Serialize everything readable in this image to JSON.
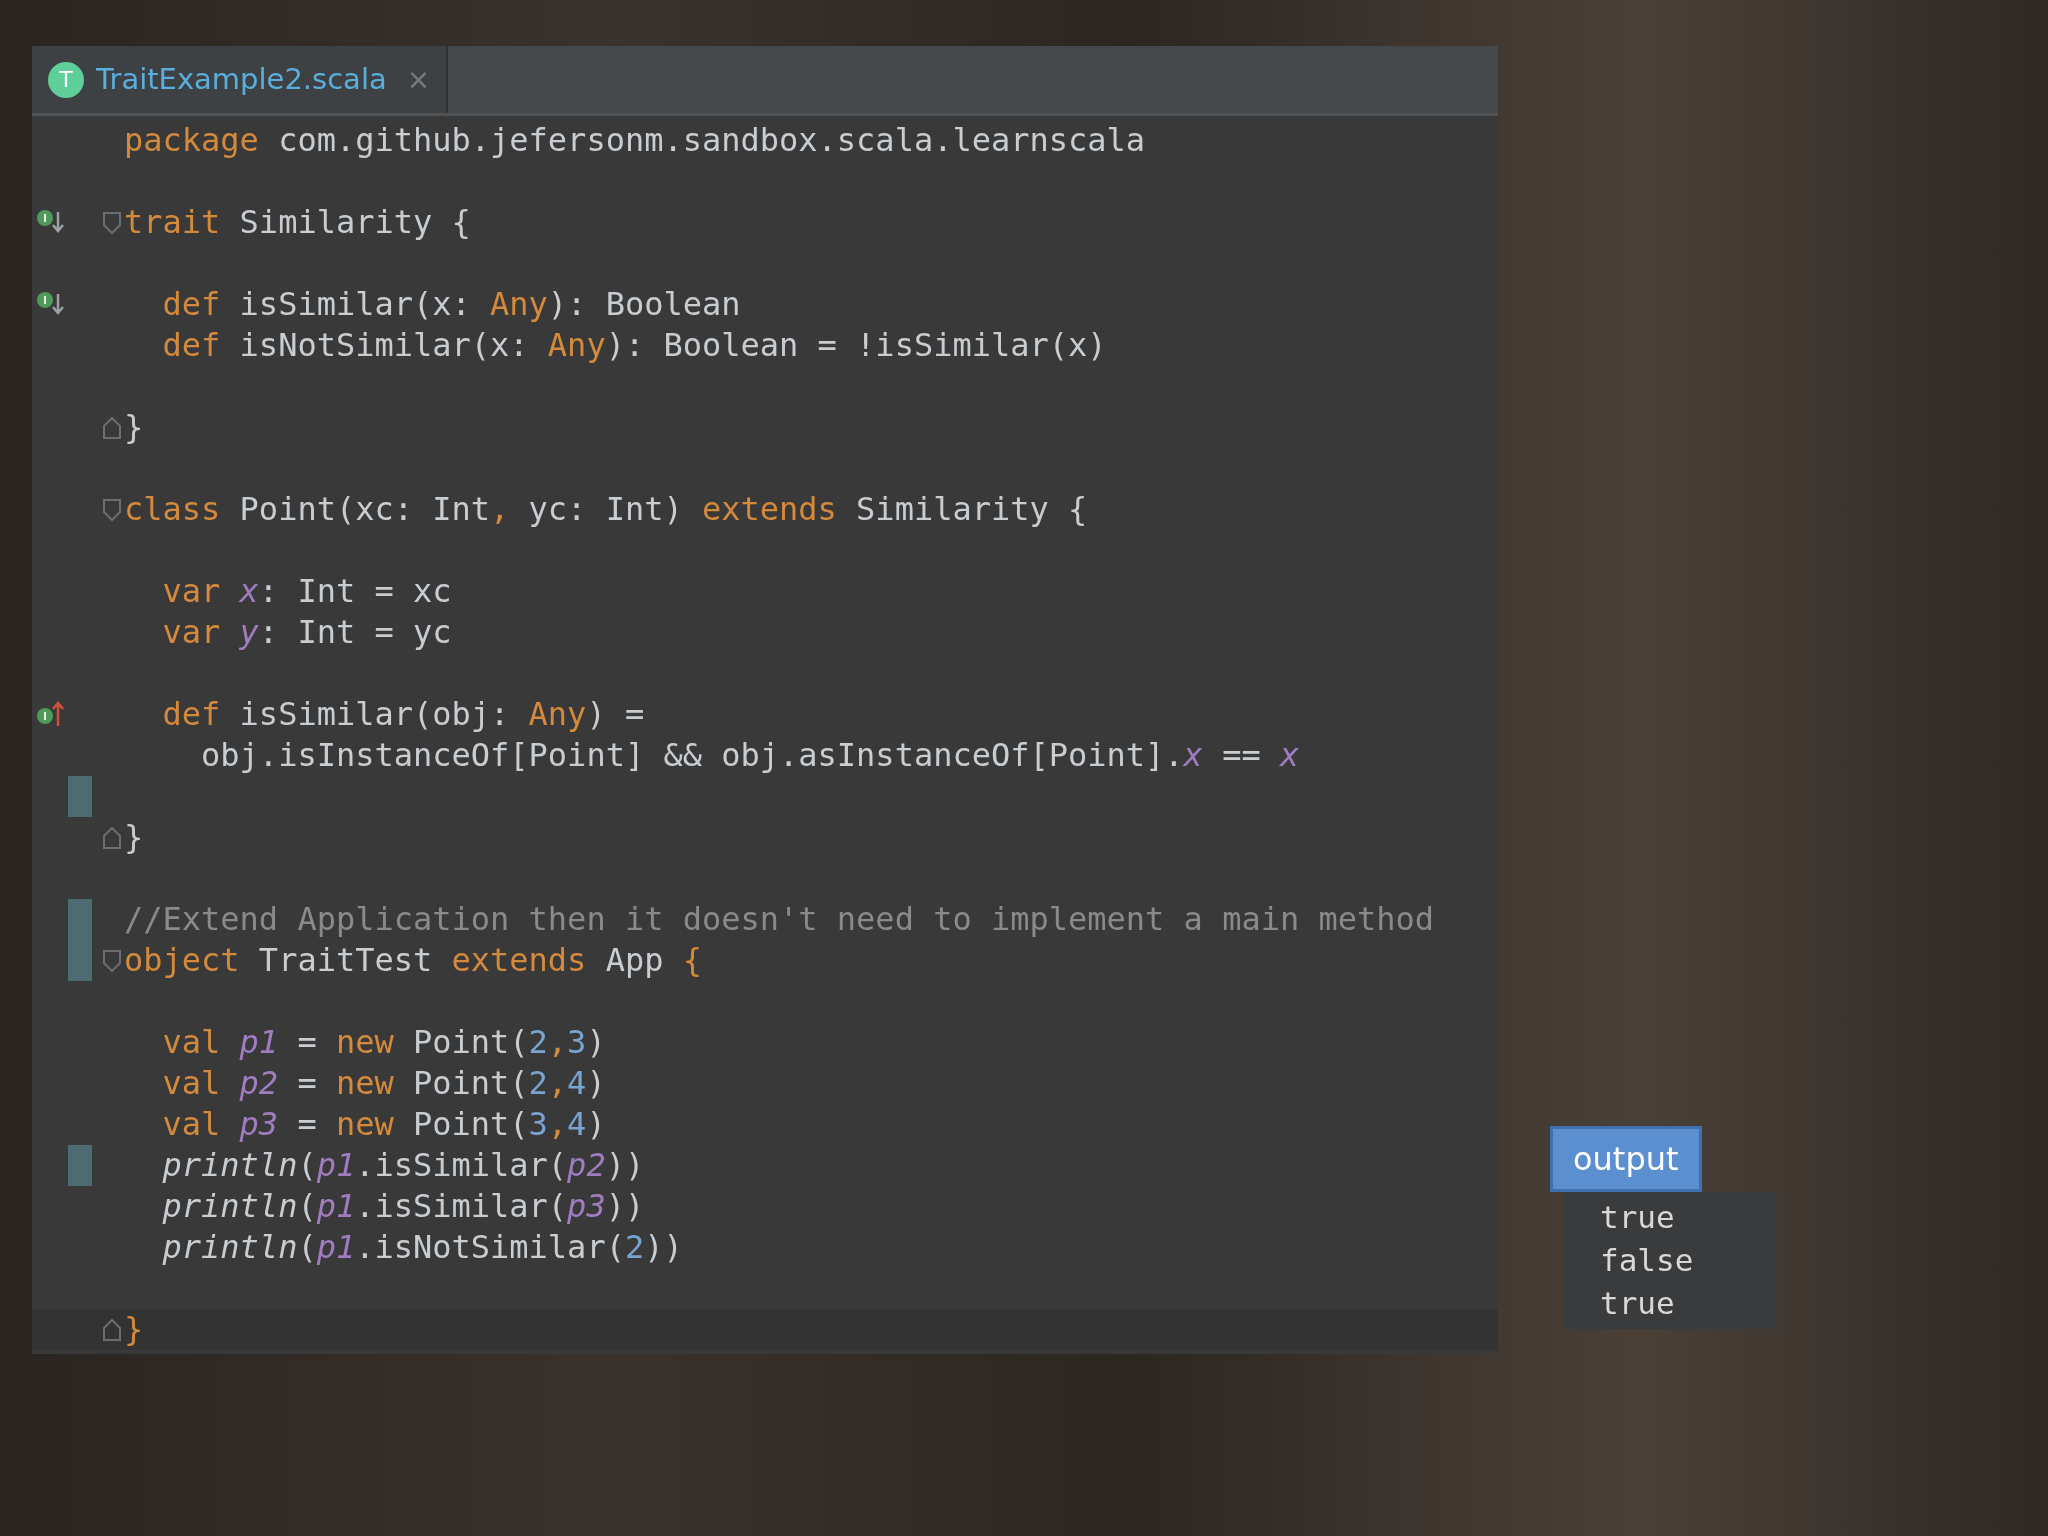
{
  "tab": {
    "icon_letter": "T",
    "label": "TraitExample2.scala",
    "close": "×",
    "selected": true
  },
  "lines": [
    {
      "kind": "code",
      "tokens": [
        {
          "kind": "kw",
          "t": "package"
        },
        {
          "kind": "plain",
          "t": " com.github.jefersonm.sandbox.scala.learnscala"
        }
      ]
    },
    {
      "kind": "blank"
    },
    {
      "kind": "code",
      "gutter": {
        "kind": "implemented"
      },
      "fold": {
        "kind": "start"
      },
      "tokens": [
        {
          "kind": "kw",
          "t": "trait"
        },
        {
          "kind": "plain",
          "t": " Similarity {"
        }
      ]
    },
    {
      "kind": "blank"
    },
    {
      "kind": "code",
      "gutter": {
        "kind": "implemented"
      },
      "tokens": [
        {
          "kind": "kw",
          "t": "  def"
        },
        {
          "kind": "plain",
          "t": " isSimilar(x: "
        },
        {
          "kind": "kw",
          "t": "Any"
        },
        {
          "kind": "plain",
          "t": "): Boolean"
        }
      ]
    },
    {
      "kind": "code",
      "tokens": [
        {
          "kind": "kw",
          "t": "  def"
        },
        {
          "kind": "plain",
          "t": " isNotSimilar(x: "
        },
        {
          "kind": "kw",
          "t": "Any"
        },
        {
          "kind": "plain",
          "t": "): Boolean = !isSimilar(x)"
        }
      ]
    },
    {
      "kind": "blank"
    },
    {
      "kind": "code",
      "fold": {
        "kind": "end"
      },
      "tokens": [
        {
          "kind": "plain",
          "t": "}"
        }
      ]
    },
    {
      "kind": "blank"
    },
    {
      "kind": "code",
      "fold": {
        "kind": "start"
      },
      "tokens": [
        {
          "kind": "kw",
          "t": "class"
        },
        {
          "kind": "plain",
          "t": " Point(xc: Int"
        },
        {
          "kind": "kw",
          "t": ","
        },
        {
          "kind": "plain",
          "t": " yc: Int) "
        },
        {
          "kind": "kw",
          "t": "extends"
        },
        {
          "kind": "plain",
          "t": " Similarity {"
        }
      ]
    },
    {
      "kind": "blank"
    },
    {
      "kind": "code",
      "tokens": [
        {
          "kind": "kw",
          "t": "  var "
        },
        {
          "kind": "field",
          "t": "x"
        },
        {
          "kind": "plain",
          "t": ": Int = xc"
        }
      ]
    },
    {
      "kind": "code",
      "tokens": [
        {
          "kind": "kw",
          "t": "  var "
        },
        {
          "kind": "field",
          "t": "y"
        },
        {
          "kind": "plain",
          "t": ": Int = yc"
        }
      ]
    },
    {
      "kind": "blank"
    },
    {
      "kind": "code",
      "gutter": {
        "kind": "overrides"
      },
      "tokens": [
        {
          "kind": "kw",
          "t": "  def"
        },
        {
          "kind": "plain",
          "t": " isSimilar(obj: "
        },
        {
          "kind": "kw",
          "t": "Any"
        },
        {
          "kind": "plain",
          "t": ") ="
        }
      ]
    },
    {
      "kind": "code",
      "tokens": [
        {
          "kind": "plain",
          "t": "    obj.isInstanceOf[Point] && obj.asInstanceOf[Point]."
        },
        {
          "kind": "field",
          "t": "x"
        },
        {
          "kind": "plain",
          "t": " == "
        },
        {
          "kind": "field",
          "t": "x"
        }
      ]
    },
    {
      "kind": "blank",
      "changed": true
    },
    {
      "kind": "code",
      "fold": {
        "kind": "end"
      },
      "tokens": [
        {
          "kind": "plain",
          "t": "}"
        }
      ]
    },
    {
      "kind": "blank"
    },
    {
      "kind": "code",
      "changed": true,
      "tokens": [
        {
          "kind": "comment",
          "t": "//Extend Application then it doesn't need to implement a main method"
        }
      ]
    },
    {
      "kind": "code",
      "changed": true,
      "fold": {
        "kind": "start"
      },
      "tokens": [
        {
          "kind": "kw",
          "t": "object"
        },
        {
          "kind": "plain",
          "t": " TraitTest "
        },
        {
          "kind": "kw",
          "t": "extends"
        },
        {
          "kind": "plain",
          "t": " App "
        },
        {
          "kind": "kw",
          "t": "{"
        }
      ]
    },
    {
      "kind": "blank"
    },
    {
      "kind": "code",
      "tokens": [
        {
          "kind": "kw",
          "t": "  val "
        },
        {
          "kind": "field",
          "t": "p1"
        },
        {
          "kind": "plain",
          "t": " = "
        },
        {
          "kind": "kw",
          "t": "new"
        },
        {
          "kind": "plain",
          "t": " Point("
        },
        {
          "kind": "num",
          "t": "2"
        },
        {
          "kind": "kw",
          "t": ","
        },
        {
          "kind": "num",
          "t": "3"
        },
        {
          "kind": "plain",
          "t": ")"
        }
      ]
    },
    {
      "kind": "code",
      "tokens": [
        {
          "kind": "kw",
          "t": "  val "
        },
        {
          "kind": "field",
          "t": "p2"
        },
        {
          "kind": "plain",
          "t": " = "
        },
        {
          "kind": "kw",
          "t": "new"
        },
        {
          "kind": "plain",
          "t": " Point("
        },
        {
          "kind": "num",
          "t": "2"
        },
        {
          "kind": "kw",
          "t": ","
        },
        {
          "kind": "num",
          "t": "4"
        },
        {
          "kind": "plain",
          "t": ")"
        }
      ]
    },
    {
      "kind": "code",
      "tokens": [
        {
          "kind": "kw",
          "t": "  val "
        },
        {
          "kind": "field",
          "t": "p3"
        },
        {
          "kind": "plain",
          "t": " = "
        },
        {
          "kind": "kw",
          "t": "new"
        },
        {
          "kind": "plain",
          "t": " Point("
        },
        {
          "kind": "num",
          "t": "3"
        },
        {
          "kind": "kw",
          "t": ","
        },
        {
          "kind": "num",
          "t": "4"
        },
        {
          "kind": "plain",
          "t": ")"
        }
      ]
    },
    {
      "kind": "code",
      "changed": true,
      "tokens": [
        {
          "kind": "call",
          "t": "  println"
        },
        {
          "kind": "plain",
          "t": "("
        },
        {
          "kind": "field",
          "t": "p1"
        },
        {
          "kind": "plain",
          "t": ".isSimilar("
        },
        {
          "kind": "field",
          "t": "p2"
        },
        {
          "kind": "plain",
          "t": "))"
        }
      ]
    },
    {
      "kind": "code",
      "tokens": [
        {
          "kind": "call",
          "t": "  println"
        },
        {
          "kind": "plain",
          "t": "("
        },
        {
          "kind": "field",
          "t": "p1"
        },
        {
          "kind": "plain",
          "t": ".isSimilar("
        },
        {
          "kind": "field",
          "t": "p3"
        },
        {
          "kind": "plain",
          "t": "))"
        }
      ]
    },
    {
      "kind": "code",
      "tokens": [
        {
          "kind": "call",
          "t": "  println"
        },
        {
          "kind": "plain",
          "t": "("
        },
        {
          "kind": "field",
          "t": "p1"
        },
        {
          "kind": "plain",
          "t": ".isNotSimilar("
        },
        {
          "kind": "num",
          "t": "2"
        },
        {
          "kind": "plain",
          "t": "))"
        }
      ]
    },
    {
      "kind": "blank"
    },
    {
      "kind": "code",
      "fold": {
        "kind": "end"
      },
      "current": true,
      "tokens": [
        {
          "kind": "kw",
          "t": "}"
        }
      ]
    }
  ],
  "output": {
    "label": "output",
    "lines": [
      "true",
      "false",
      "true"
    ]
  }
}
